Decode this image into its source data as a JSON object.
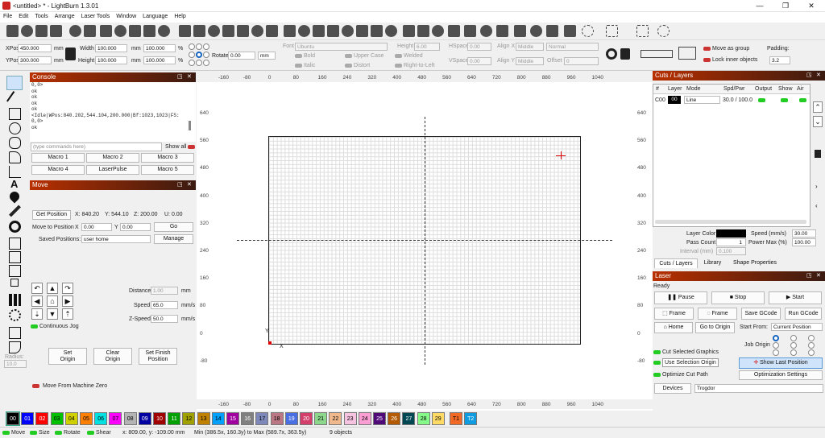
{
  "window": {
    "title": "<untitled> * - LightBurn 1.3.01"
  },
  "menu": [
    "File",
    "Edit",
    "Tools",
    "Arrange",
    "Laser Tools",
    "Window",
    "Language",
    "Help"
  ],
  "props": {
    "xpos_label": "XPos",
    "xpos": "450.000",
    "ypos_label": "YPos",
    "ypos": "300.000",
    "mm": "mm",
    "width_label": "Width",
    "width": "100.000",
    "height_label": "Height",
    "height": "100.000",
    "width_pct": "100.000",
    "height_pct": "100.000",
    "pct": "%",
    "rotate_label": "Rotate",
    "rotate": "0.00",
    "rotate_unit": "mm",
    "font_label": "Font",
    "font": "Ubuntu",
    "fheight_label": "Height",
    "fheight": "6.00",
    "hspace_label": "HSpace",
    "hspace": "0.00",
    "vspace_label": "VSpace",
    "vspace": "0.00",
    "alignx_label": "Align X",
    "alignx": "Middle",
    "aligny_label": "Align Y",
    "aligny": "Middle",
    "normal": "Normal",
    "offset_label": "Offset",
    "offset": "0",
    "bold": "Bold",
    "italic": "Italic",
    "upper": "Upper Case",
    "distort": "Distort",
    "welded": "Welded",
    "rtl": "Right-to-Left",
    "move_group": "Move as group",
    "lock_inner": "Lock inner objects",
    "padding_label": "Padding:",
    "padding": "3.2"
  },
  "console": {
    "title": "Console",
    "lines": "0,0>\nok\nok\nok\nok\n<Idle|WPos:840.202,544.104,200.000|Bf:1023,1023|FS:\n0,0>\nok",
    "placeholder": "(type commands here)",
    "show_all": "Show all",
    "macros": [
      "Macro 1",
      "Macro 2",
      "Macro 3",
      "Macro 4",
      "LaserPulse",
      "Macro 5"
    ]
  },
  "move": {
    "title": "Move",
    "get_position": "Get Position",
    "x": "X: 840.20",
    "y": "Y: 544.10",
    "z": "Z: 200.00",
    "u": "U: 0.00",
    "move_to": "Move to Position",
    "mx_label": "X",
    "mx": "0.00",
    "my_label": "Y",
    "my": "0.00",
    "go": "Go",
    "saved_label": "Saved Positions:",
    "saved": "user home",
    "manage": "Manage",
    "distance_label": "Distance",
    "distance": "1.00",
    "distance_unit": "mm",
    "speed_label": "Speed",
    "speed": "65.0",
    "speed_unit": "mm/s",
    "zspeed_label": "Z-Speed",
    "zspeed": "50.0",
    "zspeed_unit": "mm/s",
    "continuous": "Continuous Jog",
    "set_origin": "Set\nOrigin",
    "clear_origin": "Clear\nOrigin",
    "set_finish": "Set Finish\nPosition",
    "machine_zero": "Move From Machine Zero"
  },
  "left_tools": {
    "radius_label": "Radius:",
    "radius": "10.0"
  },
  "rulers": {
    "top": [
      "-160",
      "-80",
      "0",
      "80",
      "160",
      "240",
      "320",
      "400",
      "480",
      "560",
      "640",
      "720",
      "800",
      "880",
      "960",
      "1040"
    ],
    "left": [
      "640",
      "560",
      "480",
      "400",
      "320",
      "240",
      "160",
      "80",
      "0",
      "-80"
    ],
    "right": [
      "640",
      "560",
      "480",
      "400",
      "320",
      "240",
      "160",
      "80",
      "0",
      "-80"
    ]
  },
  "canvas_labels": {
    "x": "X",
    "y": "Y"
  },
  "cuts": {
    "title": "Cuts / Layers",
    "headers": [
      "#",
      "Layer",
      "Mode",
      "Spd/Pwr",
      "Output",
      "Show",
      "Air"
    ],
    "row": {
      "num": "C00",
      "layer": "00",
      "mode": "Line",
      "spdpwr": "30.0 / 100.0"
    },
    "layer_color": "Layer Color",
    "speed_label": "Speed (mm/s)",
    "speed": "30.00",
    "pass_label": "Pass Count",
    "pass": "1",
    "power_label": "Power Max (%)",
    "power": "100.00",
    "interval_label": "Interval (mm)",
    "interval": "0.100",
    "tabs": [
      "Cuts / Layers",
      "Library",
      "Shape Properties"
    ]
  },
  "laser": {
    "title": "Laser",
    "status": "Ready",
    "pause": "Pause",
    "stop": "Stop",
    "start": "Start",
    "frame1": "Frame",
    "frame2": "Frame",
    "save_gcode": "Save GCode",
    "run_gcode": "Run GCode",
    "home": "Home",
    "go_origin": "Go to Origin",
    "start_from_label": "Start From:",
    "start_from": "Current Position",
    "job_origin": "Job Origin",
    "cut_selected": "Cut Selected Graphics",
    "use_selection": "Use Selection Origin",
    "show_last": "Show Last Position",
    "optimize": "Optimize Cut Path",
    "opt_settings": "Optimization Settings",
    "devices": "Devices",
    "device": "Trogdor"
  },
  "palette": [
    {
      "l": "00",
      "c": "#000000",
      "t": "#fff"
    },
    {
      "l": "01",
      "c": "#0000ff",
      "t": "#fff"
    },
    {
      "l": "02",
      "c": "#ff0000",
      "t": "#fff"
    },
    {
      "l": "03",
      "c": "#00c000",
      "t": "#000"
    },
    {
      "l": "04",
      "c": "#d0d000",
      "t": "#000"
    },
    {
      "l": "05",
      "c": "#ff8000",
      "t": "#000"
    },
    {
      "l": "06",
      "c": "#00e0e0",
      "t": "#000"
    },
    {
      "l": "07",
      "c": "#ff00ff",
      "t": "#000"
    },
    {
      "l": "08",
      "c": "#b4b4b4",
      "t": "#000"
    },
    {
      "l": "09",
      "c": "#0000a0",
      "t": "#fff"
    },
    {
      "l": "10",
      "c": "#a00000",
      "t": "#fff"
    },
    {
      "l": "11",
      "c": "#00a000",
      "t": "#fff"
    },
    {
      "l": "12",
      "c": "#a0a000",
      "t": "#000"
    },
    {
      "l": "13",
      "c": "#c08000",
      "t": "#000"
    },
    {
      "l": "14",
      "c": "#00a0ff",
      "t": "#000"
    },
    {
      "l": "15",
      "c": "#a000a0",
      "t": "#fff"
    },
    {
      "l": "16",
      "c": "#808080",
      "t": "#fff"
    },
    {
      "l": "17",
      "c": "#7d87b9",
      "t": "#000"
    },
    {
      "l": "18",
      "c": "#bb7784",
      "t": "#000"
    },
    {
      "l": "19",
      "c": "#4a6fe3",
      "t": "#fff"
    },
    {
      "l": "20",
      "c": "#d33f6a",
      "t": "#fff"
    },
    {
      "l": "21",
      "c": "#8cd78c",
      "t": "#000"
    },
    {
      "l": "22",
      "c": "#f0b98d",
      "t": "#000"
    },
    {
      "l": "23",
      "c": "#f6c4e1",
      "t": "#000"
    },
    {
      "l": "24",
      "c": "#fa9ed4",
      "t": "#000"
    },
    {
      "l": "25",
      "c": "#500a78",
      "t": "#fff"
    },
    {
      "l": "26",
      "c": "#b45a00",
      "t": "#fff"
    },
    {
      "l": "27",
      "c": "#004754",
      "t": "#fff"
    },
    {
      "l": "28",
      "c": "#86fa88",
      "t": "#000"
    },
    {
      "l": "29",
      "c": "#ffdb66",
      "t": "#000"
    },
    {
      "l": "T1",
      "c": "#f36926",
      "t": "#000"
    },
    {
      "l": "T2",
      "c": "#0f9be0",
      "t": "#fff"
    }
  ],
  "status": {
    "move": "Move",
    "size": "Size",
    "rotate": "Rotate",
    "shear": "Shear",
    "coords": "x: 809.00, y: -109.00 mm",
    "extent": "Min (386.5x, 160.3y) to Max (589.7x, 363.5y)",
    "count": "9 objects"
  },
  "colors": {
    "accent": "#b83000",
    "selected": "#cfe4fa"
  }
}
